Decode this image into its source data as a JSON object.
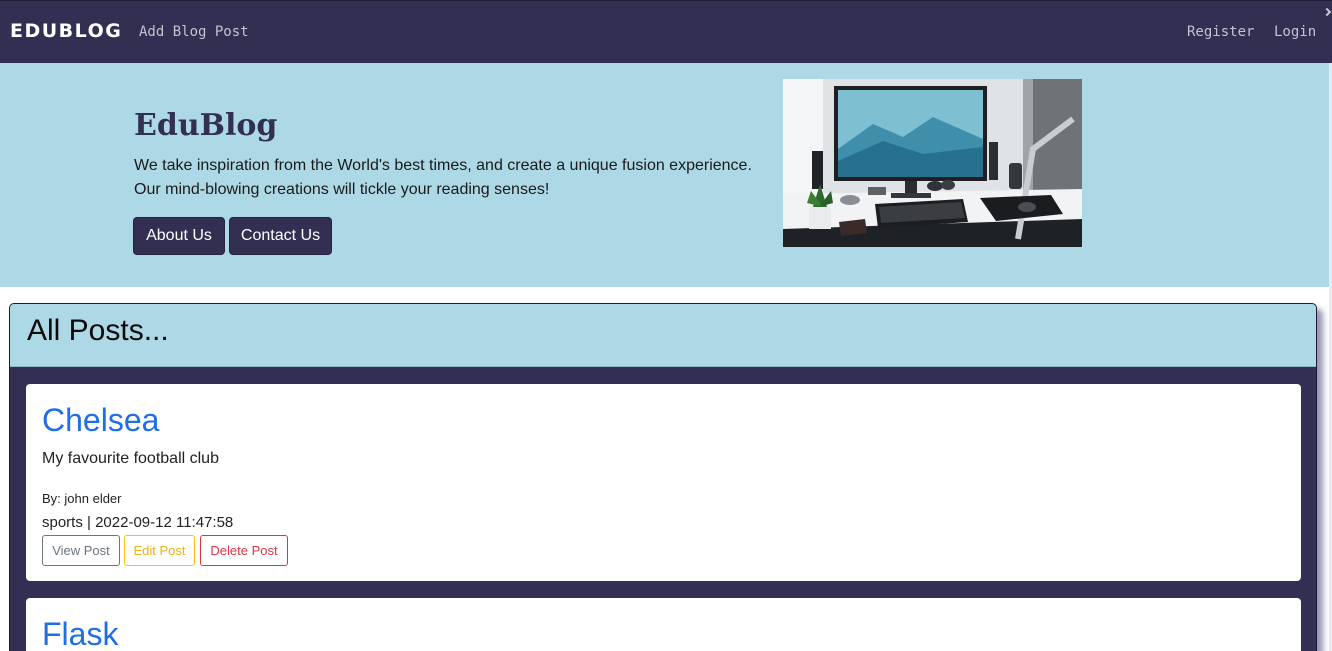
{
  "navbar": {
    "brand": "EDUBLOG",
    "add_post": "Add Blog Post",
    "register": "Register",
    "login": "Login"
  },
  "hero": {
    "title": "EduBlog",
    "line1": "We take inspiration from the World's best times, and create a unique fusion experience.",
    "line2": "Our mind-blowing creations will tickle your reading senses!",
    "about_btn": "About Us",
    "contact_btn": "Contact Us"
  },
  "posts": {
    "header": "All Posts...",
    "items": [
      {
        "title": "Chelsea",
        "description": "My favourite football club",
        "author": "By: john elder",
        "meta": "sports | 2022-09-12 11:47:58",
        "view": "View Post",
        "edit": "Edit Post",
        "delete": "Delete Post"
      },
      {
        "title": "Flask"
      }
    ]
  },
  "colors": {
    "navbar": "#332f53",
    "hero_bg": "#add8e6",
    "link_blue": "#1e6fe6"
  }
}
